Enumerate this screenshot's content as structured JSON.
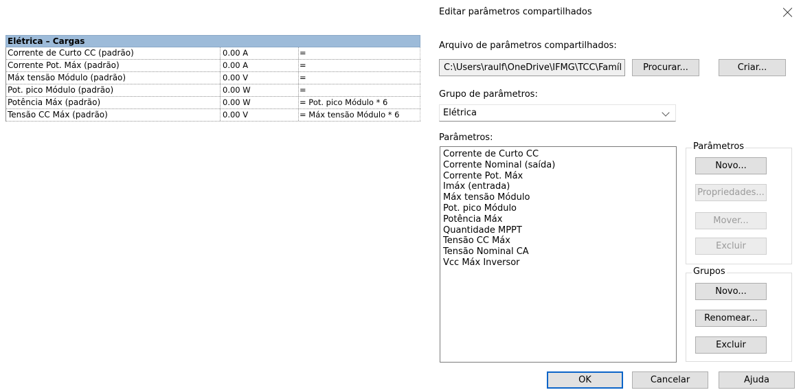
{
  "table": {
    "group": "Elétrica – Cargas",
    "rows": [
      {
        "name": "Corrente de Curto CC (padrão)",
        "value": "0.00 A",
        "formula": "="
      },
      {
        "name": "Corrente Pot. Máx (padrão)",
        "value": "0.00 A",
        "formula": "="
      },
      {
        "name": "Máx tensão Módulo (padrão)",
        "value": "0.00 V",
        "formula": "="
      },
      {
        "name": "Pot. pico Módulo (padrão)",
        "value": "0.00 W",
        "formula": "="
      },
      {
        "name": "Potência Máx (padrão)",
        "value": "0.00 W",
        "formula": "= Pot. pico Módulo * 6"
      },
      {
        "name": "Tensão CC Máx (padrão)",
        "value": "0.00 V",
        "formula": "= Máx tensão Módulo * 6"
      }
    ]
  },
  "dialog": {
    "title": "Editar parâmetros compartilhados",
    "file_label": "Arquivo de parâmetros compartilhados:",
    "file_path": "C:\\Users\\raulf\\OneDrive\\IFMG\\TCC\\Famíl",
    "browse_label": "Procurar...",
    "create_label": "Criar...",
    "group_label": "Grupo de parâmetros:",
    "group_value": "Elétrica",
    "params_label": "Parâmetros:",
    "params": [
      "Corrente de Curto CC",
      "Corrente Nominal (saída)",
      "Corrente Pot. Máx",
      "Imáx (entrada)",
      "Máx tensão Módulo",
      "Pot. pico Módulo",
      "Potência Máx",
      "Quantidade MPPT",
      "Tensão CC Máx",
      "Tensão Nominal CA",
      "Vcc Máx Inversor"
    ],
    "params_box": {
      "title": "Parâmetros",
      "new_label": "Novo...",
      "properties_label": "Propriedades...",
      "move_label": "Mover...",
      "delete_label": "Excluir"
    },
    "groups_box": {
      "title": "Grupos",
      "new_label": "Novo...",
      "rename_label": "Renomear...",
      "delete_label": "Excluir"
    },
    "ok_label": "OK",
    "cancel_label": "Cancelar",
    "help_label": "Ajuda"
  }
}
